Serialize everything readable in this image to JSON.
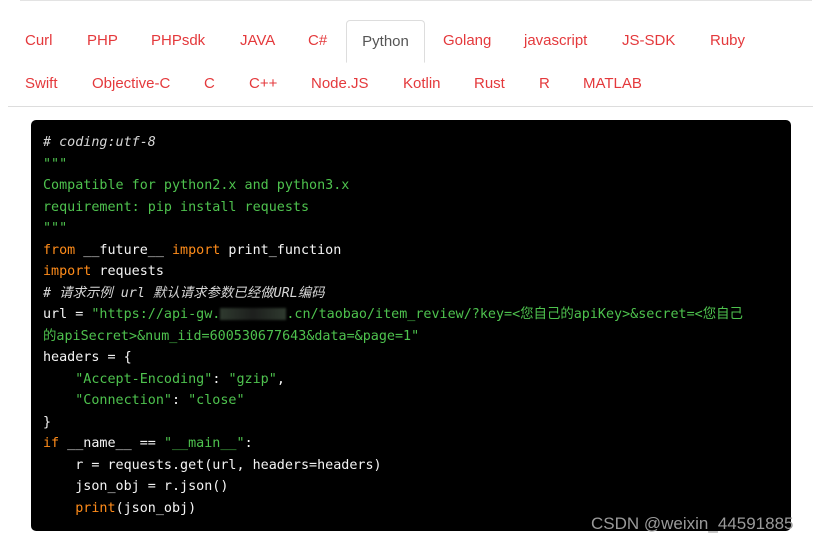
{
  "tabs": {
    "row1": [
      "Curl",
      "PHP",
      "PHPsdk",
      "JAVA",
      "C#",
      "Python",
      "Golang",
      "javascript",
      "JS-SDK",
      "Ruby"
    ],
    "row2": [
      "Swift",
      "Objective-C",
      "C",
      "C++",
      "Node.JS",
      "Kotlin",
      "Rust",
      "R",
      "MATLAB"
    ],
    "active": "Python"
  },
  "code": {
    "l1_comment": "# coding:utf-8",
    "l2_doc": "\"\"\"",
    "l3_doc": "Compatible for python2.x and python3.x",
    "l4_doc": "requirement: pip install requests",
    "l5_doc": "\"\"\"",
    "l6_kw1": "from",
    "l6_mod": " __future__ ",
    "l6_kw2": "import",
    "l6_name": " print_function",
    "l7_kw": "import",
    "l7_name": " requests",
    "l8_comment": "# 请求示例 url 默认请求参数已经做URL编码",
    "l9_pre": "url = ",
    "l9_str_a": "\"https://api-gw.",
    "l9_str_b": ".cn/taobao/item_review/?key=<您自己的apiKey>&secret=<您自己",
    "l10_str": "的apiSecret>&num_iid=600530677643&data=&page=1\"",
    "l11": "headers = {",
    "l12_indent": "    ",
    "l12_key": "\"Accept-Encoding\"",
    "l12_sep": ": ",
    "l12_val": "\"gzip\"",
    "l12_end": ",",
    "l13_indent": "    ",
    "l13_key": "\"Connection\"",
    "l13_sep": ": ",
    "l13_val": "\"close\"",
    "l14": "}",
    "l15_kw": "if",
    "l15_mid": " __name__ == ",
    "l15_str": "\"__main__\"",
    "l15_end": ":",
    "l16": "    r = requests.get(url, headers=headers)",
    "l17": "    json_obj = r.json()",
    "l18_indent": "    ",
    "l18_kw": "print",
    "l18_rest": "(json_obj)"
  },
  "watermark": "CSDN @weixin_44591885",
  "colors": {
    "tab_link": "#e4393c",
    "tab_active": "#555555",
    "code_bg": "#000000",
    "code_string": "#4ec24e",
    "code_keyword": "#ff8c1a"
  }
}
